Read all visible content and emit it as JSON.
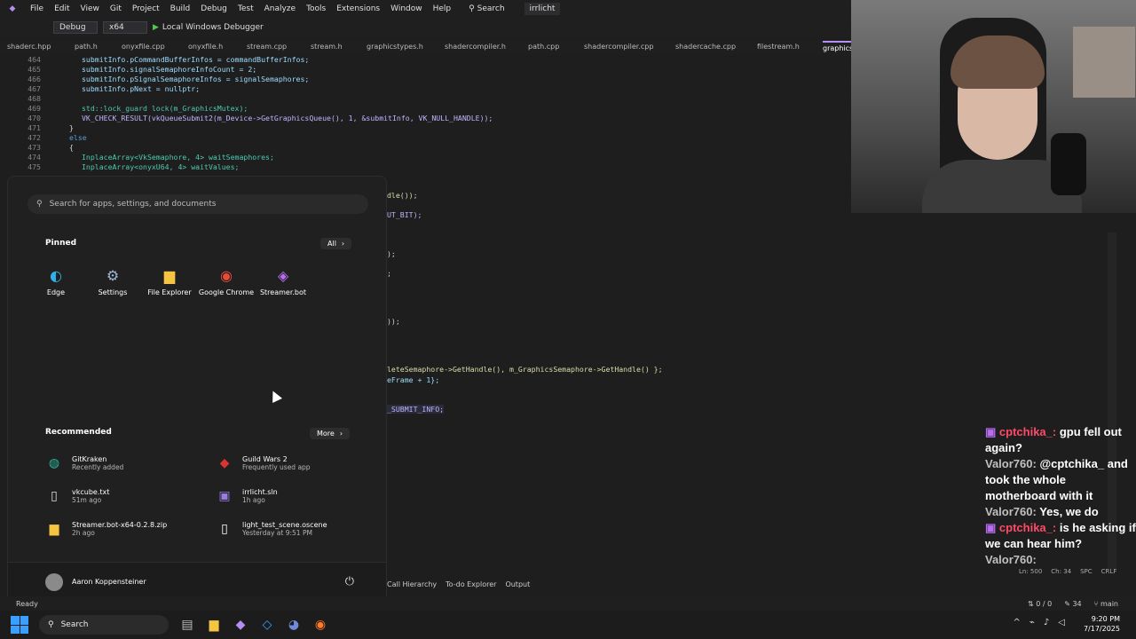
{
  "menubar": {
    "items": [
      "File",
      "Edit",
      "View",
      "Git",
      "Project",
      "Build",
      "Debug",
      "Test",
      "Analyze",
      "Tools",
      "Extensions",
      "Window",
      "Help"
    ],
    "search": "Search",
    "solution": "irrlicht"
  },
  "toolbar": {
    "config": "Debug",
    "platform": "x64",
    "run_label": "Local Windows Debugger"
  },
  "tabs": [
    "shaderc.hpp",
    "path.h",
    "onyxfile.cpp",
    "onyxfile.h",
    "stream.cpp",
    "stream.h",
    "graphicstypes.h",
    "shadercompiler.h",
    "path.cpp",
    "shadercompiler.cpp",
    "shadercache.cpp",
    "filestream.h",
    "graphics"
  ],
  "code": {
    "lines": [
      {
        "n": "464",
        "text": "submitInfo.pCommandBufferInfos = commandBufferInfos;"
      },
      {
        "n": "465",
        "text": "submitInfo.signalSemaphoreInfoCount = 2;"
      },
      {
        "n": "466",
        "text": "submitInfo.pSignalSemaphoreInfos = signalSemaphores;"
      },
      {
        "n": "467",
        "text": "submitInfo.pNext = nullptr;"
      },
      {
        "n": "468",
        "text": ""
      },
      {
        "n": "469",
        "text": "std::lock_guard lock(m_GraphicsMutex);"
      },
      {
        "n": "470",
        "text": "VK_CHECK_RESULT(vkQueueSubmit2(m_Device->GetGraphicsQueue(), 1, &submitInfo, VK_NULL_HANDLE));"
      },
      {
        "n": "471",
        "text": "}"
      },
      {
        "n": "472",
        "text": "else"
      },
      {
        "n": "473",
        "text": "{"
      },
      {
        "n": "474",
        "text": "InplaceArray<VkSemaphore, 4> waitSemaphores;"
      },
      {
        "n": "475",
        "text": "InplaceArray<onyxU64, 4> waitValues;"
      }
    ],
    "fragments": [
      "dle());",
      "UT_BIT);",
      ");",
      ";",
      "));",
      "leteSemaphore->GetHandle(), m_GraphicsSemaphore->GetHandle() };",
      "eFrame + 1};",
      "_SUBMIT_INFO;"
    ]
  },
  "startmenu": {
    "search_placeholder": "Search for apps, settings, and documents",
    "pinned_label": "Pinned",
    "all_label": "All",
    "pinned": [
      {
        "label": "Edge",
        "icon": "edge-icon"
      },
      {
        "label": "Settings",
        "icon": "settings-icon"
      },
      {
        "label": "File Explorer",
        "icon": "folder-icon"
      },
      {
        "label": "Google Chrome",
        "icon": "chrome-icon"
      },
      {
        "label": "Streamer.bot",
        "icon": "streamerbot-icon"
      }
    ],
    "recommended_label": "Recommended",
    "more_label": "More",
    "recommended": [
      {
        "name": "GitKraken",
        "sub": "Recently added",
        "icon": "gitkraken-icon"
      },
      {
        "name": "Guild Wars 2",
        "sub": "Frequently used app",
        "icon": "guildwars-icon"
      },
      {
        "name": "vkcube.txt",
        "sub": "51m ago",
        "icon": "file-icon"
      },
      {
        "name": "irrlicht.sln",
        "sub": "1h ago",
        "icon": "sln-icon"
      },
      {
        "name": "Streamer.bot-x64-0.2.8.zip",
        "sub": "2h ago",
        "icon": "folder-zip-icon"
      },
      {
        "name": "light_test_scene.oscene",
        "sub": "Yesterday at 9:51 PM",
        "icon": "file-icon"
      }
    ],
    "user": "Aaron Koppensteiner"
  },
  "chat": [
    {
      "user": "cptchika_:",
      "text": "gpu fell out again?",
      "badge": true
    },
    {
      "user": "Valor760:",
      "text": "@cptchika_ and took the whole motherboard with it"
    },
    {
      "user": "Valor760:",
      "text": "Yes, we do"
    },
    {
      "user": "cptchika_:",
      "text": "is he asking if we can hear him?",
      "badge": true
    },
    {
      "user": "Valor760:",
      "text": ""
    }
  ],
  "bottom_tabs": [
    "Call Hierarchy",
    "To-do Explorer",
    "Output"
  ],
  "statusbar": {
    "ready": "Ready",
    "position": "Ln: 500",
    "char": "Ch: 34",
    "spc": "SPC",
    "crlf": "CRLF",
    "git_changes": "0 / 0",
    "edits": "34",
    "branch": "main"
  },
  "taskbar": {
    "search": "Search",
    "time": "9:20 PM",
    "date": "7/17/2025"
  },
  "colors": {
    "accent": "#3aa0ff",
    "chat_user_red": "#ff4a6a"
  }
}
